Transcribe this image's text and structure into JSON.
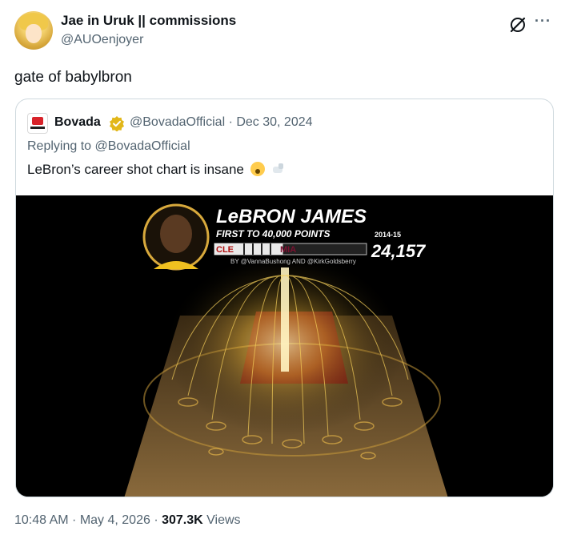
{
  "author": {
    "name": "Jae in Uruk || commissions",
    "handle": "@AUOenjoyer"
  },
  "tweet": {
    "text": "gate of babylbron"
  },
  "quoted": {
    "name": "Bovada",
    "handle_date": "@BovadaOfficial · Dec 30, 2024",
    "replying_prefix": "Replying to ",
    "replying_handle": "@BovadaOfficial",
    "text": "LeBron’s career shot chart is insane"
  },
  "media": {
    "player_name": "LeBRON JAMES",
    "subtitle": "FIRST TO 40,000 POINTS",
    "team_left": "CLE",
    "team_right": "MIA",
    "credit": "BY @VannaBushong AND @KirkGoldsberry",
    "season": "2014-15",
    "points": "24,157",
    "progress_fraction": 0.45
  },
  "meta": {
    "time_date": "10:48 AM · May 4, 2026 · ",
    "views_count": "307.3K",
    "views_label": " Views"
  },
  "icons": {
    "grok": "grok-icon",
    "more": "more-icon",
    "verified": "verified-badge-icon"
  },
  "colors": {
    "verified_gold": "#e2b719",
    "text_secondary": "#536471",
    "border": "#cfd9de"
  }
}
